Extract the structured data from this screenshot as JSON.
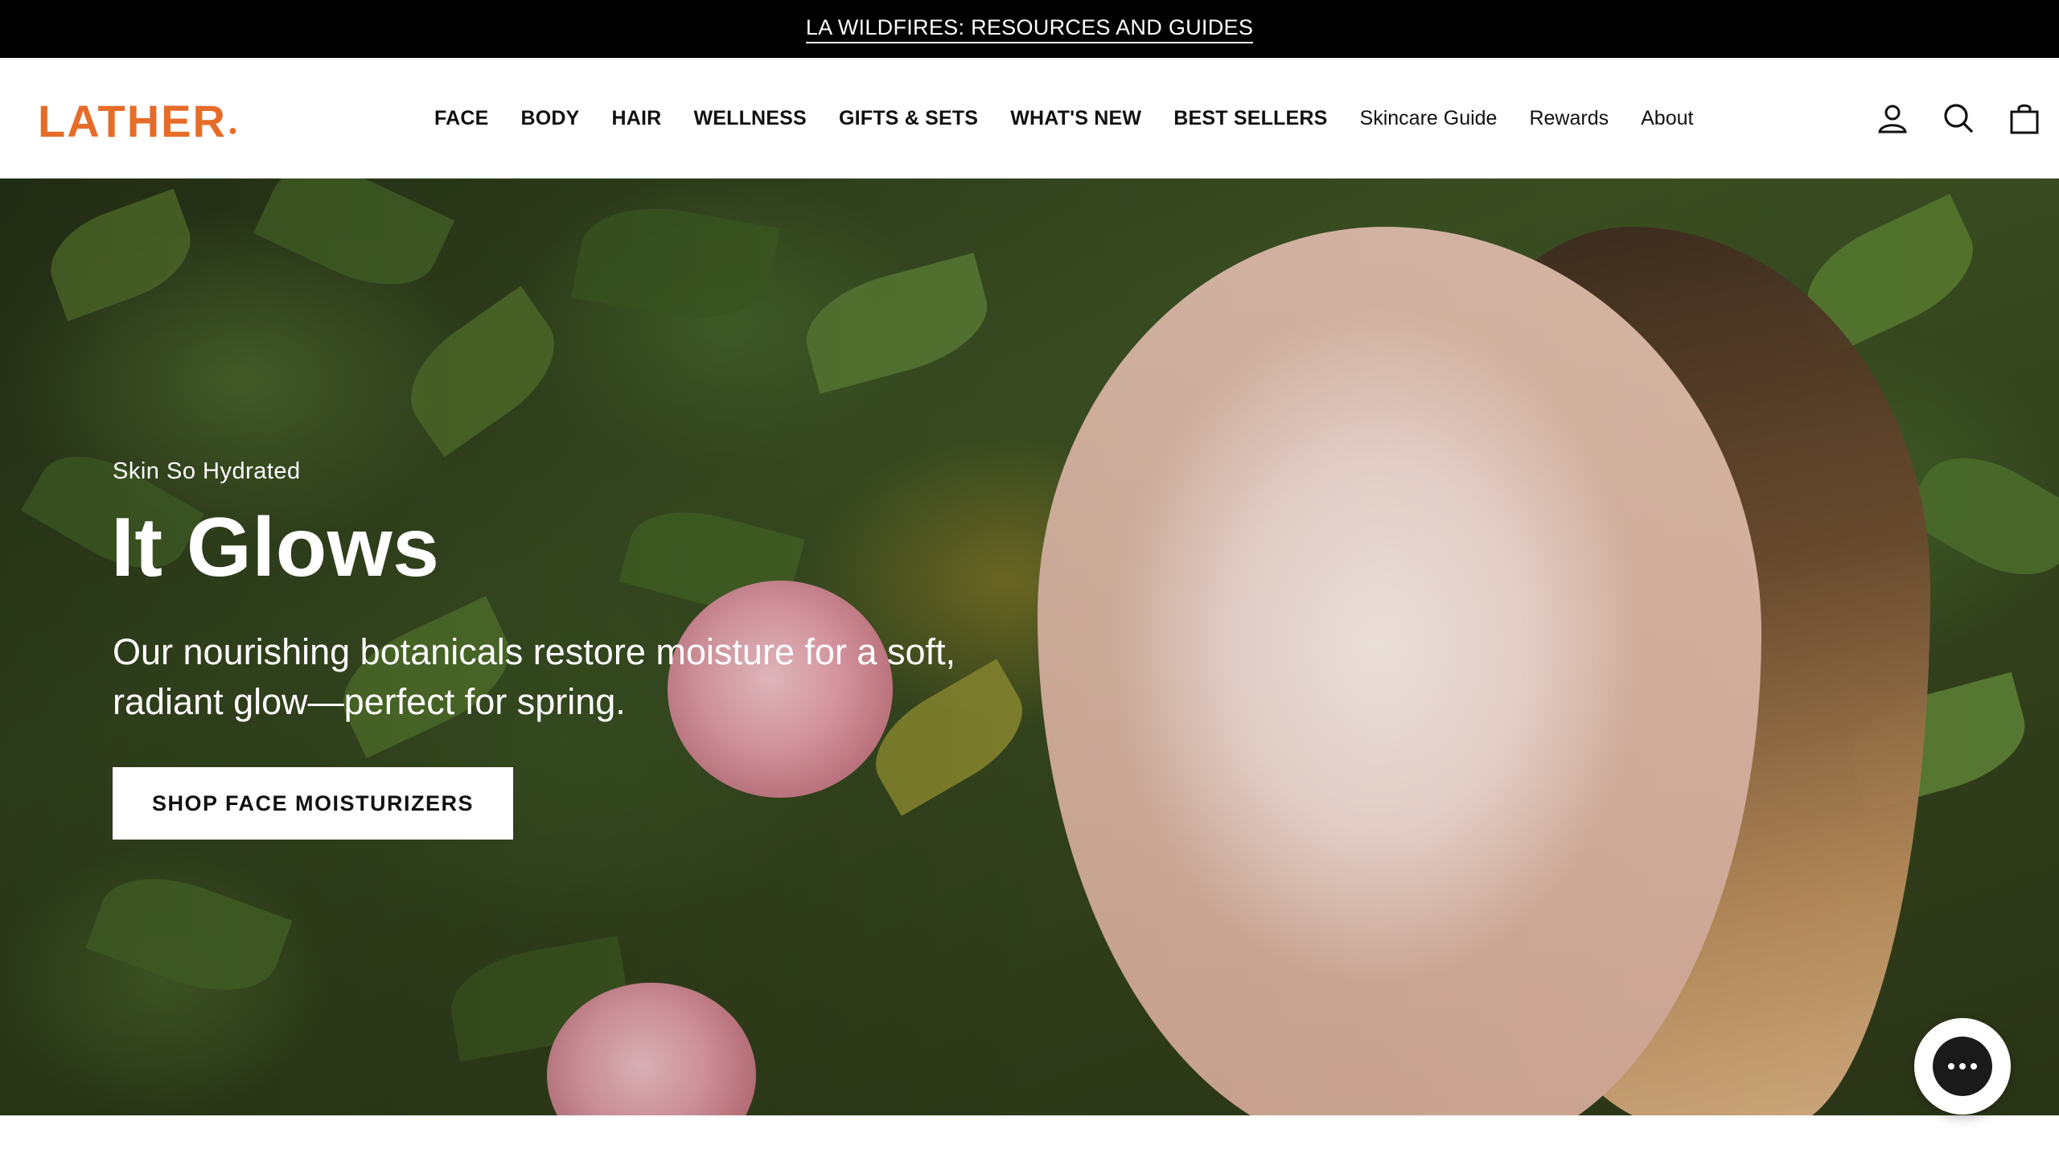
{
  "announcement": {
    "text": "LA WILDFIRES: RESOURCES AND GUIDES"
  },
  "brand": {
    "logo_text": "LATHER",
    "logo_dot": "●",
    "accent_color": "#e56d29"
  },
  "nav": {
    "items": [
      {
        "label": "FACE"
      },
      {
        "label": "BODY"
      },
      {
        "label": "HAIR"
      },
      {
        "label": "WELLNESS"
      },
      {
        "label": "GIFTS & SETS"
      },
      {
        "label": "WHAT'S NEW"
      },
      {
        "label": "BEST SELLERS"
      },
      {
        "label": "Skincare Guide"
      },
      {
        "label": "Rewards"
      },
      {
        "label": "About"
      }
    ]
  },
  "header_icons": [
    "account-icon",
    "search-icon",
    "cart-icon"
  ],
  "hero": {
    "eyebrow": "Skin So Hydrated",
    "title": "It Glows",
    "subtitle": "Our nourishing botanicals restore moisture for a soft, radiant glow—perfect for spring.",
    "cta_label": "SHOP FACE MOISTURIZERS"
  },
  "chat": {
    "icon": "chat-icon"
  }
}
